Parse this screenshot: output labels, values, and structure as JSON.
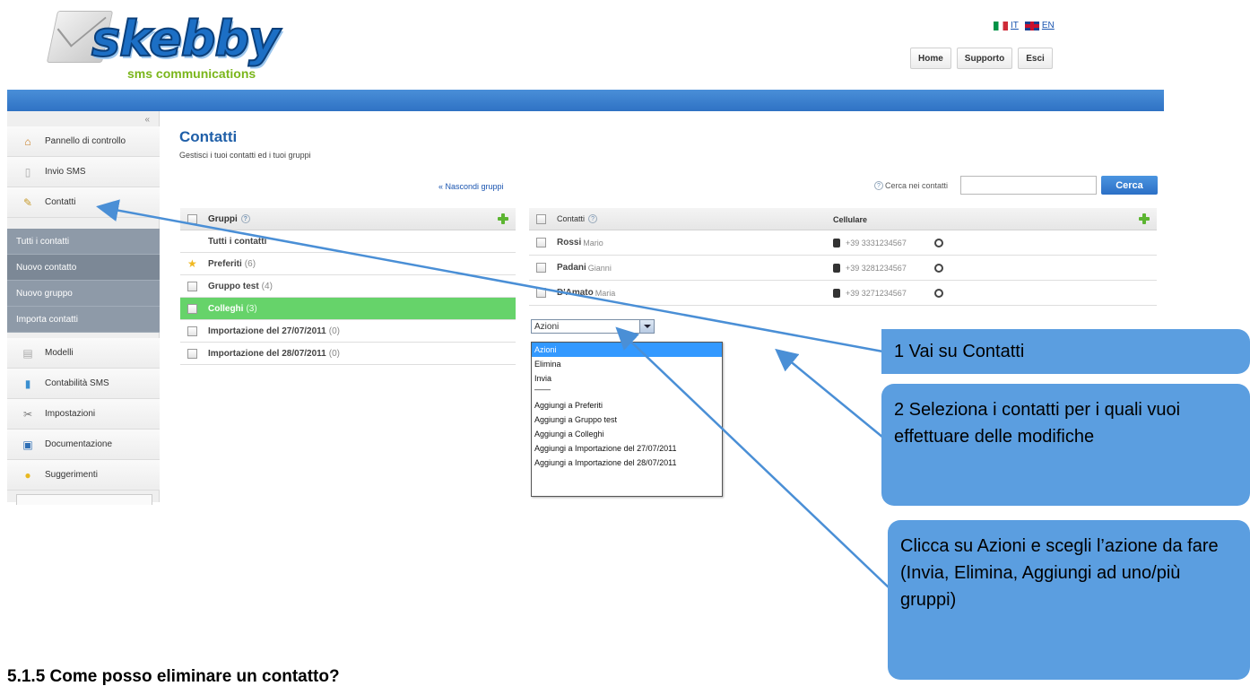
{
  "brand": {
    "name": "skebby",
    "tagline": "sms communications"
  },
  "languages": [
    {
      "code": "IT",
      "label": "IT"
    },
    {
      "code": "EN",
      "label": "EN"
    }
  ],
  "top_nav": {
    "home": "Home",
    "support": "Supporto",
    "logout": "Esci"
  },
  "sidebar": {
    "collapse": "«",
    "items": [
      {
        "label": "Pannello di controllo",
        "icon": "home-icon"
      },
      {
        "label": "Invio SMS",
        "icon": "document-icon"
      },
      {
        "label": "Contatti",
        "icon": "contacts-icon"
      },
      {
        "label": "Modelli",
        "icon": "templates-icon"
      },
      {
        "label": "Contabilità SMS",
        "icon": "chart-icon"
      },
      {
        "label": "Impostazioni",
        "icon": "settings-icon"
      },
      {
        "label": "Documentazione",
        "icon": "book-icon"
      },
      {
        "label": "Suggerimenti",
        "icon": "lightbulb-icon"
      }
    ],
    "sub_items": [
      "Tutti i contatti",
      "Nuovo contatto",
      "Nuovo gruppo",
      "Importa contatti"
    ]
  },
  "main": {
    "title": "Contatti",
    "subtitle": "Gestisci i tuoi contatti ed i tuoi gruppi",
    "hide_groups": "« Nascondi gruppi",
    "search": {
      "label": "Cerca nei contatti",
      "value": "",
      "button": "Cerca"
    }
  },
  "groups": {
    "header": "Gruppi",
    "rows": [
      {
        "name": "Tutti i contatti",
        "count": ""
      },
      {
        "name": "Preferiti",
        "count": "(6)"
      },
      {
        "name": "Gruppo test",
        "count": "(4)"
      },
      {
        "name": "Colleghi",
        "count": "(3)"
      },
      {
        "name": "Importazione del 27/07/2011",
        "count": "(0)"
      },
      {
        "name": "Importazione del 28/07/2011",
        "count": "(0)"
      }
    ]
  },
  "contacts": {
    "header": "Contatti",
    "phone_header": "Cellulare",
    "rows": [
      {
        "last": "Rossi",
        "first": "Mario",
        "phone": "+39 3331234567"
      },
      {
        "last": "Padani",
        "first": "Gianni",
        "phone": "+39 3281234567"
      },
      {
        "last": "D'Amato",
        "first": "Maria",
        "phone": "+39 3271234567"
      }
    ]
  },
  "actions": {
    "selected": "Azioni",
    "options": [
      "Azioni",
      "Elimina",
      "Invia",
      "——",
      "Aggiungi a Preferiti",
      "Aggiungi a Gruppo test",
      "Aggiungi a Colleghi",
      "Aggiungi a Importazione del 27/07/2011",
      "Aggiungi a Importazione del 28/07/2011"
    ]
  },
  "callouts": {
    "c1": "1 Vai su Contatti",
    "c2": "2 Seleziona i contatti per i quali vuoi effettuare delle modifiche",
    "c3": "Clicca su Azioni e scegli l’azione da fare (Invia, Elimina, Aggiungi ad uno/più gruppi)"
  },
  "section_heading": "5.1.5   Come posso eliminare un contatto?",
  "colors": {
    "accent": "#2f72c4",
    "selected_group": "#66d36a",
    "callout": "#5b9ee0"
  }
}
